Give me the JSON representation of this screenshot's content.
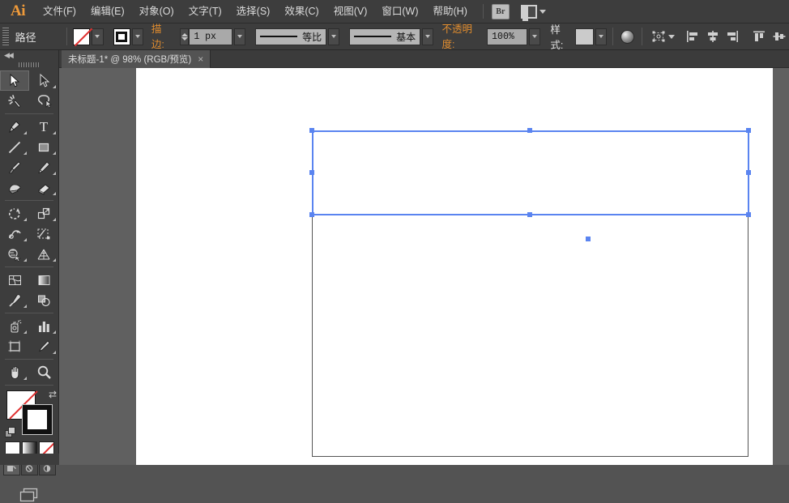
{
  "app": {
    "name": "Ai",
    "logo_color": "#ee9a3a"
  },
  "menubar": {
    "items": [
      {
        "label": "文件(F)",
        "name": "menu-file"
      },
      {
        "label": "编辑(E)",
        "name": "menu-edit"
      },
      {
        "label": "对象(O)",
        "name": "menu-object"
      },
      {
        "label": "文字(T)",
        "name": "menu-type"
      },
      {
        "label": "选择(S)",
        "name": "menu-select"
      },
      {
        "label": "效果(C)",
        "name": "menu-effect"
      },
      {
        "label": "视图(V)",
        "name": "menu-view"
      },
      {
        "label": "窗口(W)",
        "name": "menu-window"
      },
      {
        "label": "帮助(H)",
        "name": "menu-help"
      }
    ],
    "bridge_label": "Br",
    "arrange_documents_tooltip": "排列文档"
  },
  "controlbar": {
    "selection_type": "路径",
    "fill_label": "填色",
    "fill_value": "无",
    "stroke_swatch_label": "描边颜色",
    "stroke_label": "描边:",
    "stroke_weight": "1 px",
    "profile_label": "等比",
    "brush_label": "基本",
    "opacity_label": "不透明度:",
    "opacity_value": "100%",
    "style_label": "样式:",
    "style_value": "无",
    "graphic_styles_tooltip": "图形样式",
    "transform_label": "变换",
    "align_buttons": [
      {
        "name": "align-left-icon",
        "label": "水平左对齐"
      },
      {
        "name": "align-center-horizontal-icon",
        "label": "水平居中对齐"
      },
      {
        "name": "align-right-icon",
        "label": "水平右对齐"
      },
      {
        "name": "align-top-icon",
        "label": "垂直顶对齐"
      },
      {
        "name": "align-middle-vertical-icon",
        "label": "垂直居中对齐"
      }
    ]
  },
  "document": {
    "tab_title": "未标题-1* @ 98% (RGB/预览)",
    "close_glyph": "×",
    "zoom": "98%",
    "color_mode": "RGB",
    "view_mode": "预览",
    "modified": true
  },
  "toolpanel": {
    "collapse_glyph": "◀◀",
    "tools": [
      {
        "name": "selection-tool",
        "label": "选择工具",
        "active": true,
        "corner": false
      },
      {
        "name": "direct-selection-tool",
        "label": "直接选择工具",
        "active": false,
        "corner": true
      },
      {
        "name": "magic-wand-tool",
        "label": "魔棒工具",
        "active": false,
        "corner": false
      },
      {
        "name": "lasso-tool",
        "label": "套索工具",
        "active": false,
        "corner": false
      },
      {
        "name": "pen-tool",
        "label": "钢笔工具",
        "active": false,
        "corner": true
      },
      {
        "name": "type-tool",
        "label": "文字工具",
        "active": false,
        "corner": true
      },
      {
        "name": "line-segment-tool",
        "label": "直线段工具",
        "active": false,
        "corner": true
      },
      {
        "name": "rectangle-tool",
        "label": "矩形工具",
        "active": false,
        "corner": true
      },
      {
        "name": "paintbrush-tool",
        "label": "画笔工具",
        "active": false,
        "corner": false
      },
      {
        "name": "pencil-tool",
        "label": "铅笔工具",
        "active": false,
        "corner": true
      },
      {
        "name": "blob-brush-tool",
        "label": "斑点画笔工具",
        "active": false,
        "corner": false
      },
      {
        "name": "eraser-tool",
        "label": "橡皮擦工具",
        "active": false,
        "corner": true
      },
      {
        "name": "rotate-tool",
        "label": "旋转工具",
        "active": false,
        "corner": true
      },
      {
        "name": "scale-tool",
        "label": "比例缩放工具",
        "active": false,
        "corner": true
      },
      {
        "name": "width-tool",
        "label": "宽度工具",
        "active": false,
        "corner": true
      },
      {
        "name": "free-transform-tool",
        "label": "自由变换工具",
        "active": false,
        "corner": false
      },
      {
        "name": "shape-builder-tool",
        "label": "形状生成器工具",
        "active": false,
        "corner": true
      },
      {
        "name": "perspective-grid-tool",
        "label": "透视网格工具",
        "active": false,
        "corner": true
      },
      {
        "name": "mesh-tool",
        "label": "网格工具",
        "active": false,
        "corner": false
      },
      {
        "name": "gradient-tool",
        "label": "渐变工具",
        "active": false,
        "corner": false
      },
      {
        "name": "eyedropper-tool",
        "label": "吸管工具",
        "active": false,
        "corner": true
      },
      {
        "name": "blend-tool",
        "label": "混合工具",
        "active": false,
        "corner": false
      },
      {
        "name": "symbol-sprayer-tool",
        "label": "符号喷枪工具",
        "active": false,
        "corner": true
      },
      {
        "name": "column-graph-tool",
        "label": "柱形图工具",
        "active": false,
        "corner": true
      },
      {
        "name": "artboard-tool",
        "label": "画板工具",
        "active": false,
        "corner": false
      },
      {
        "name": "slice-tool",
        "label": "切片工具",
        "active": false,
        "corner": true
      },
      {
        "name": "hand-tool",
        "label": "抓手工具",
        "active": false,
        "corner": true
      },
      {
        "name": "zoom-tool",
        "label": "缩放工具",
        "active": false,
        "corner": false
      }
    ],
    "color_controls": {
      "fill": "无",
      "stroke": "黑色",
      "swap_glyph": "⇄",
      "modes": [
        {
          "name": "color-mode-button",
          "label": "颜色"
        },
        {
          "name": "gradient-mode-button",
          "label": "渐变"
        },
        {
          "name": "none-mode-button",
          "label": "无"
        }
      ],
      "draw_modes": [
        {
          "name": "draw-normal-button",
          "label": "正常绘图",
          "selected": true
        },
        {
          "name": "draw-behind-button",
          "label": "背面绘图",
          "selected": false
        },
        {
          "name": "draw-inside-button",
          "label": "内部绘图",
          "selected": false
        }
      ],
      "screen_mode": {
        "name": "change-screen-mode-button",
        "label": "更改屏幕模式"
      }
    }
  },
  "canvas": {
    "selection": {
      "visible": true,
      "handles": 8,
      "center_point": true,
      "color": "#5a84f0"
    },
    "artboard": {
      "border_color": "#555555",
      "background": "#ffffff"
    },
    "workspace_background": "#606060",
    "page_background": "#ffffff"
  }
}
